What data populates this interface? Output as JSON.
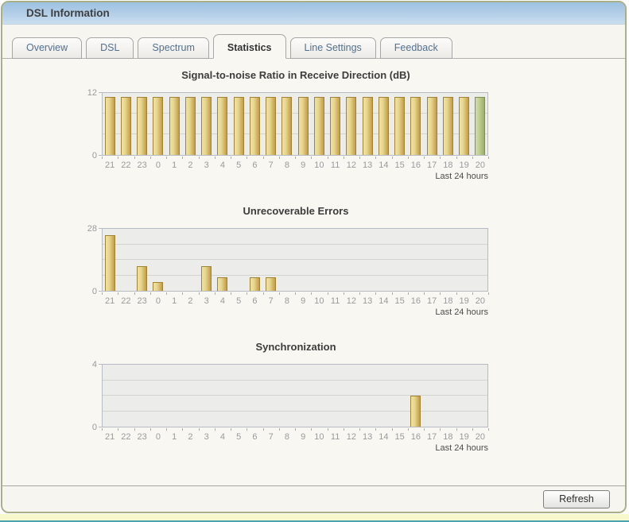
{
  "window": {
    "title": "DSL Information"
  },
  "tabs": [
    {
      "label": "Overview",
      "active": false
    },
    {
      "label": "DSL",
      "active": false
    },
    {
      "label": "Spectrum",
      "active": false
    },
    {
      "label": "Statistics",
      "active": true
    },
    {
      "label": "Line Settings",
      "active": false
    },
    {
      "label": "Feedback",
      "active": false
    }
  ],
  "footer": {
    "refresh_label": "Refresh"
  },
  "colors": {
    "header_blue": "#b4cfe8",
    "panel_border": "#a9af88",
    "bar_gold_light": "#eee2a4",
    "bar_gold_dark": "#c49c45",
    "bar_green_light": "#d2dca8",
    "bar_green_dark": "#9cae67",
    "plot_bg": "#ececea",
    "page_bottom_yellow": "#f8f8cd",
    "page_bottom_teal": "#4aa4b0"
  },
  "chart_data": [
    {
      "type": "bar",
      "title": "Signal-to-noise Ratio in Receive Direction (dB)",
      "categories": [
        "21",
        "22",
        "23",
        "0",
        "1",
        "2",
        "3",
        "4",
        "5",
        "6",
        "7",
        "8",
        "9",
        "10",
        "11",
        "12",
        "13",
        "14",
        "15",
        "16",
        "17",
        "18",
        "19",
        "20"
      ],
      "values": [
        11.2,
        11.2,
        11.2,
        11.2,
        11.2,
        11.2,
        11.2,
        11.2,
        11.2,
        11.2,
        11.2,
        11.2,
        11.2,
        11.2,
        11.2,
        11.2,
        11.2,
        11.2,
        11.2,
        11.2,
        11.2,
        11.2,
        11.2,
        11.2
      ],
      "ylim": [
        0,
        12
      ],
      "grid_step": 4,
      "grid": true,
      "legend": "none",
      "caption": "Last 24 hours",
      "highlight_last": true
    },
    {
      "type": "bar",
      "title": "Unrecoverable Errors",
      "categories": [
        "21",
        "22",
        "23",
        "0",
        "1",
        "2",
        "3",
        "4",
        "5",
        "6",
        "7",
        "8",
        "9",
        "10",
        "11",
        "12",
        "13",
        "14",
        "15",
        "16",
        "17",
        "18",
        "19",
        "20"
      ],
      "values": [
        25,
        0,
        11,
        4,
        0,
        0,
        11,
        6,
        0,
        6,
        6,
        0,
        0,
        0,
        0,
        0,
        0,
        0,
        0,
        0,
        0,
        0,
        0,
        0
      ],
      "ylim": [
        0,
        28
      ],
      "grid_step": 7,
      "grid": true,
      "legend": "none",
      "caption": "Last 24 hours",
      "highlight_last": false
    },
    {
      "type": "bar",
      "title": "Synchronization",
      "categories": [
        "21",
        "22",
        "23",
        "0",
        "1",
        "2",
        "3",
        "4",
        "5",
        "6",
        "7",
        "8",
        "9",
        "10",
        "11",
        "12",
        "13",
        "14",
        "15",
        "16",
        "17",
        "18",
        "19",
        "20"
      ],
      "values": [
        0,
        0,
        0,
        0,
        0,
        0,
        0,
        0,
        0,
        0,
        0,
        0,
        0,
        0,
        0,
        0,
        0,
        0,
        0,
        2,
        0,
        0,
        0,
        0
      ],
      "ylim": [
        0,
        4
      ],
      "grid_step": 1,
      "grid": true,
      "legend": "none",
      "caption": "Last 24 hours",
      "highlight_last": false
    }
  ]
}
